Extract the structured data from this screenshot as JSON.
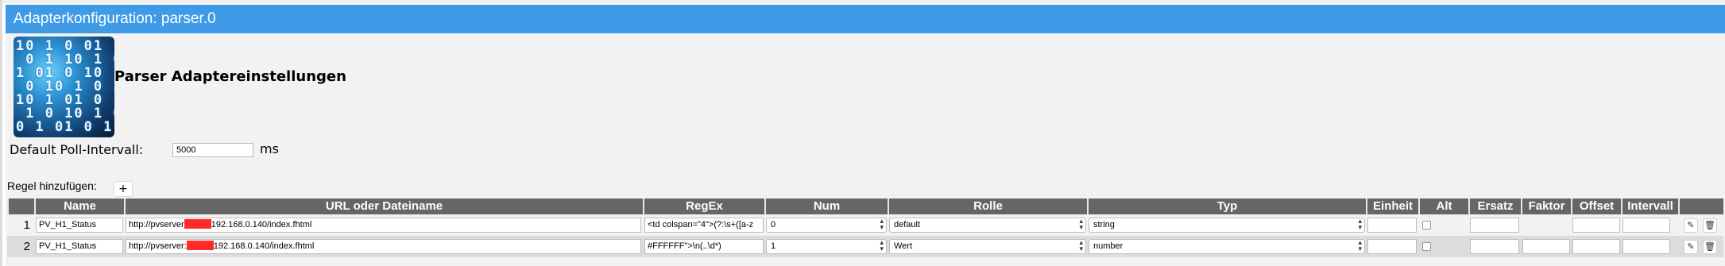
{
  "window": {
    "title": "Adapterkonfiguration: parser.0"
  },
  "header": {
    "settings_title": "Parser Adaptereinstellungen",
    "logo_icon": "binary-digits-logo"
  },
  "settings": {
    "poll_label": "Default Poll-Intervall:",
    "poll_value": "5000",
    "poll_unit": "ms"
  },
  "rules": {
    "add_label": "Regel hinzufügen:",
    "add_button": "+",
    "columns": [
      "Name",
      "URL oder Dateiname",
      "RegEx",
      "Num",
      "Rolle",
      "Typ",
      "Einheit",
      "Alt",
      "Ersatz",
      "Faktor",
      "Offset",
      "Intervall"
    ],
    "rows": [
      {
        "index": "1",
        "name": "PV_H1_Status",
        "url_prefix": "http://pvserver",
        "url_suffix": "192.168.0.140/index.fhtml",
        "regex": "<td colspan=\"4\">(?:\\s+([a-z",
        "num": "0",
        "rolle": "default",
        "typ": "string",
        "einheit": "",
        "alt": false,
        "ersatz": "",
        "faktor": "",
        "offset": "",
        "intervall": ""
      },
      {
        "index": "2",
        "name": "PV_H1_Status",
        "url_prefix": "http://pvserver:",
        "url_suffix": "192.168.0.140/index.fhtml",
        "regex": "#FFFFFF\">\\n(..\\d*)",
        "num": "1",
        "rolle": "Wert",
        "typ": "number",
        "einheit": "",
        "alt": false,
        "ersatz": "",
        "faktor": "",
        "offset": "",
        "intervall": ""
      }
    ]
  },
  "colors": {
    "titlebar": "#3f9ae8",
    "table_header": "#666666",
    "redaction": "#ff2a2a"
  },
  "icons": {
    "edit": "edit-pencil-icon",
    "delete": "trash-icon"
  }
}
